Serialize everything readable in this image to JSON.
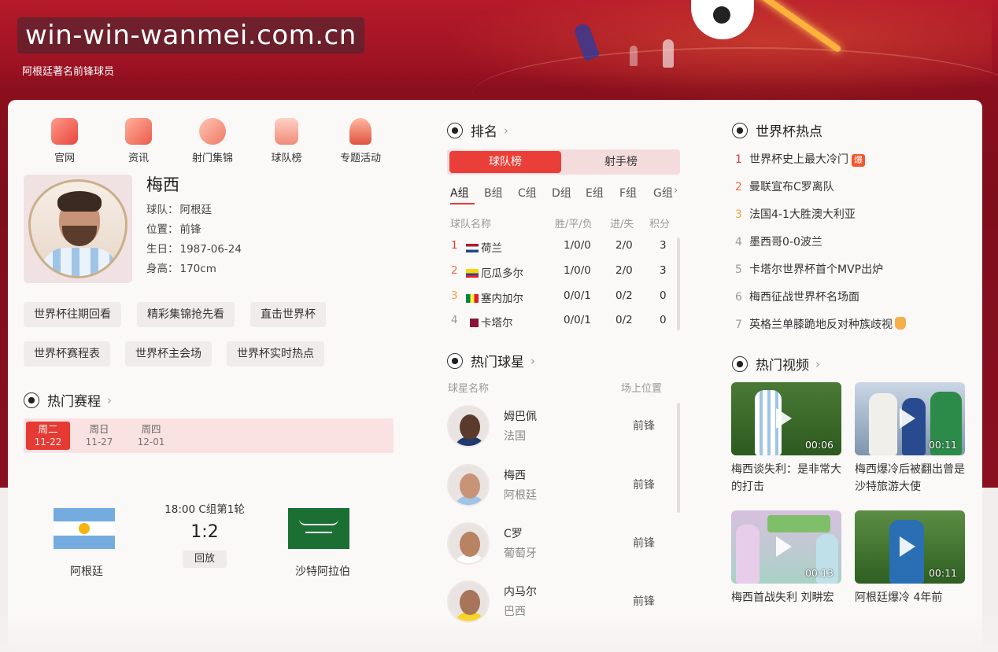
{
  "header": {
    "watermark": "win-win-wanmei.com.cn",
    "subtitle": "阿根廷著名前锋球员"
  },
  "nav": [
    "官网",
    "资讯",
    "射门集锦",
    "球队榜",
    "专题活动"
  ],
  "player": {
    "name": "梅西",
    "team_label": "球队：",
    "team": "阿根廷",
    "position_label": "位置：",
    "position": "前锋",
    "birth_label": "生日：",
    "birth": "1987-06-24",
    "height_label": "身高：",
    "height": "170cm"
  },
  "tags": [
    "世界杯往期回看",
    "精彩集锦抢先看",
    "直击世界杯",
    "世界杯赛程表",
    "世界杯主会场",
    "世界杯实时热点"
  ],
  "schedule": {
    "title": "热门赛程",
    "days": [
      {
        "w": "周二",
        "d": "11-22"
      },
      {
        "w": "周日",
        "d": "11-27"
      },
      {
        "w": "周四",
        "d": "12-01"
      }
    ],
    "match": {
      "time": "18:00  C组第1轮",
      "score": "1:2",
      "replay": "回放",
      "home": "阿根廷",
      "away": "沙特阿拉伯"
    }
  },
  "ranking": {
    "title": "排名",
    "tabs": [
      "球队榜",
      "射手榜"
    ],
    "groups": [
      "A组",
      "B组",
      "C组",
      "D组",
      "E组",
      "F组",
      "G组"
    ],
    "headers": [
      "球队名称",
      "胜/平/负",
      "进/失",
      "积分"
    ],
    "rows": [
      {
        "rank": "1",
        "team": "荷兰",
        "wdl": "1/0/0",
        "gd": "2/0",
        "pts": "3"
      },
      {
        "rank": "2",
        "team": "厄瓜多尔",
        "wdl": "1/0/0",
        "gd": "2/0",
        "pts": "3"
      },
      {
        "rank": "3",
        "team": "塞内加尔",
        "wdl": "0/0/1",
        "gd": "0/2",
        "pts": "0"
      },
      {
        "rank": "4",
        "team": "卡塔尔",
        "wdl": "0/0/1",
        "gd": "0/2",
        "pts": "0"
      }
    ]
  },
  "stars": {
    "title": "热门球星",
    "headers": [
      "球星名称",
      "场上位置"
    ],
    "rows": [
      {
        "name": "姆巴佩",
        "nation": "法国",
        "pos": "前锋"
      },
      {
        "name": "梅西",
        "nation": "阿根廷",
        "pos": "前锋"
      },
      {
        "name": "C罗",
        "nation": "葡萄牙",
        "pos": "前锋"
      },
      {
        "name": "内马尔",
        "nation": "巴西",
        "pos": "前锋"
      }
    ]
  },
  "hot": {
    "title": "世界杯热点",
    "badge": "爆",
    "items": [
      "世界杯史上最大冷门",
      "曼联宣布C罗离队",
      "法国4-1大胜澳大利亚",
      "墨西哥0-0波兰",
      "卡塔尔世界杯首个MVP出炉",
      "梅西征战世界杯名场面",
      "英格兰单膝跪地反对种族歧视"
    ]
  },
  "videos": {
    "title": "热门视频",
    "items": [
      {
        "dur": "00:06",
        "cap": "梅西谈失利：是非常大的打击"
      },
      {
        "dur": "00:11",
        "cap": "梅西爆冷后被翻出曾是沙特旅游大使"
      },
      {
        "dur": "00:13",
        "cap": "梅西首战失利 刘畊宏"
      },
      {
        "dur": "00:11",
        "cap": "阿根廷爆冷 4年前"
      }
    ]
  },
  "colors": {
    "accent": "#e63a34",
    "banner": "#9c1222"
  }
}
